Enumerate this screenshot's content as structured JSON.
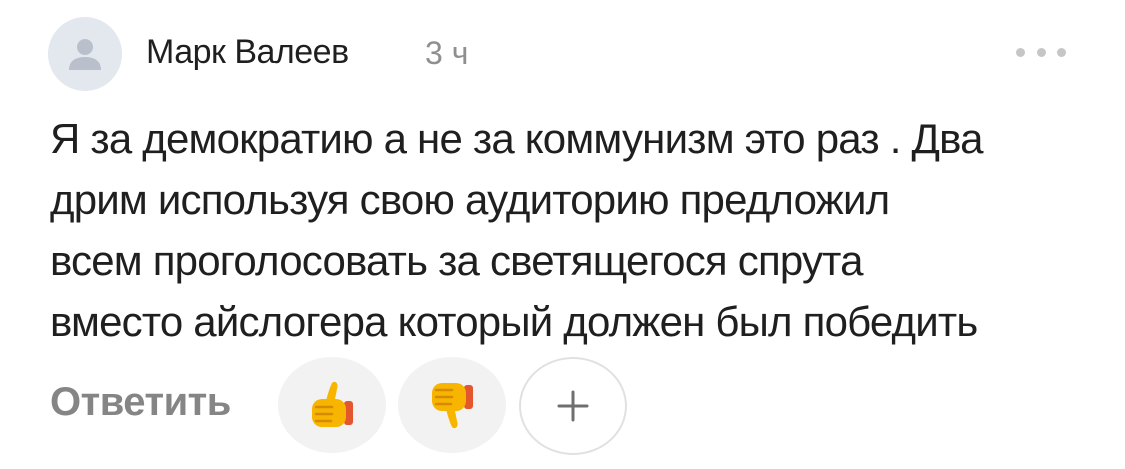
{
  "comment": {
    "author": "Марк Валеев",
    "time": "3 ч",
    "text_lines": [
      "Я за демократию а не за коммунизм это раз . Два",
      "дрим используя свою аудиторию предложил",
      "всем проголосовать за светящегося спрута",
      "вместо айслогера который должен был победить"
    ],
    "reply_label": "Ответить"
  },
  "icons": {
    "avatar": "user-placeholder-icon",
    "more": "ellipsis-icon",
    "like": "thumbs-up-emoji",
    "dislike": "thumbs-down-emoji",
    "add": "plus-icon"
  },
  "colors": {
    "text": "#1f1f1f",
    "muted": "#8f8f8f",
    "reply": "#858585",
    "avatar_bg": "#e3e7ee",
    "avatar_fg": "#b9c0cb",
    "reaction_bg": "#f2f2f2",
    "emoji_yellow": "#f7b500",
    "emoji_red": "#e4572e"
  }
}
